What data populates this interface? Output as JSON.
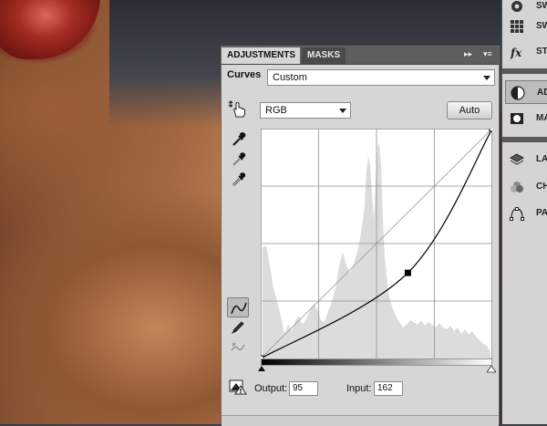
{
  "tabs": [
    {
      "label": "ADJUSTMENTS",
      "active": true
    },
    {
      "label": "MASKS",
      "active": false
    }
  ],
  "panel_controls": {
    "collapse_glyph": "▸▸",
    "menu_glyph": "▾≡"
  },
  "adjustment": {
    "type_label": "Curves",
    "preset": "Custom",
    "channel": "RGB",
    "auto_label": "Auto"
  },
  "curve": {
    "control_points": [
      [
        0,
        0
      ],
      [
        162,
        95
      ],
      [
        255,
        255
      ]
    ],
    "output": "95",
    "input": "162",
    "output_label": "Output:",
    "input_label": "Input:"
  },
  "dock": {
    "items": [
      {
        "icon": "swatches-icon",
        "label": "SW"
      },
      {
        "icon": "styles-icon",
        "label": "ST"
      },
      {
        "icon": "adjustments-icon",
        "label": "AD",
        "active": true
      },
      {
        "icon": "masks-icon",
        "label": "MA"
      },
      {
        "icon": "layers-icon",
        "label": "LA"
      },
      {
        "icon": "channels-icon",
        "label": "CH"
      },
      {
        "icon": "paths-icon",
        "label": "PA"
      }
    ]
  }
}
